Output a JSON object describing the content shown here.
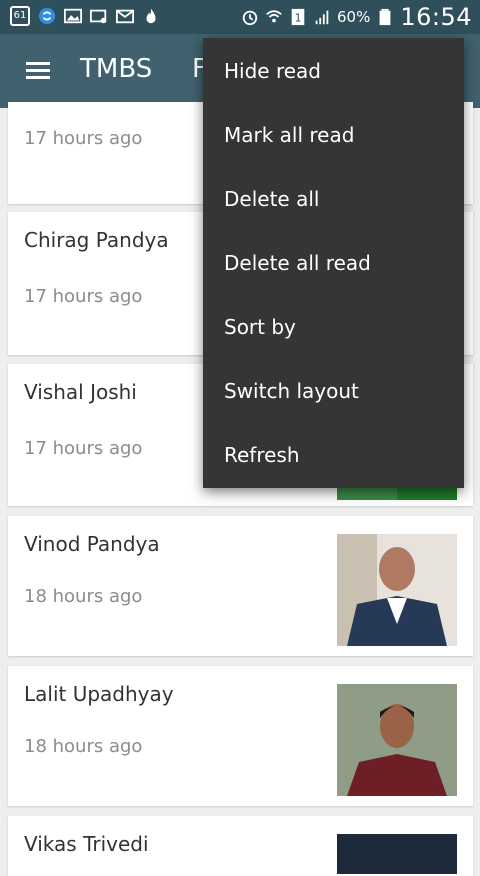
{
  "statusbar": {
    "notification_count": "61",
    "battery_percent": "60%",
    "time": "16:54",
    "icons": [
      "notification-count-icon",
      "sync-icon",
      "image-icon",
      "gallery-icon",
      "mail-icon",
      "flame-icon",
      "alarm-icon",
      "wifi-icon",
      "sim-icon",
      "signal-icon",
      "battery-icon"
    ]
  },
  "appbar": {
    "title": "TMBS",
    "title_partial": "F",
    "menu_icon": "hamburger-menu-icon"
  },
  "cards": [
    {
      "name": "",
      "time": "17 hours ago",
      "has_thumb": false
    },
    {
      "name": "Chirag Pandya",
      "time": "17 hours ago",
      "has_thumb": false
    },
    {
      "name": "Vishal Joshi",
      "time": "17 hours ago",
      "has_thumb": true
    },
    {
      "name": "Vinod Pandya",
      "time": "18 hours ago",
      "has_thumb": true
    },
    {
      "name": "Lalit Upadhyay",
      "time": "18 hours ago",
      "has_thumb": true
    },
    {
      "name": "Vikas Trivedi",
      "time": "",
      "has_thumb": true
    }
  ],
  "overflow_menu": {
    "items": [
      "Hide read",
      "Mark all read",
      "Delete all",
      "Delete all read",
      "Sort by",
      "Switch layout",
      "Refresh"
    ]
  },
  "colors": {
    "statusbar": "#2f4f5b",
    "appbar": "#40616d",
    "menu_bg": "#353535"
  }
}
